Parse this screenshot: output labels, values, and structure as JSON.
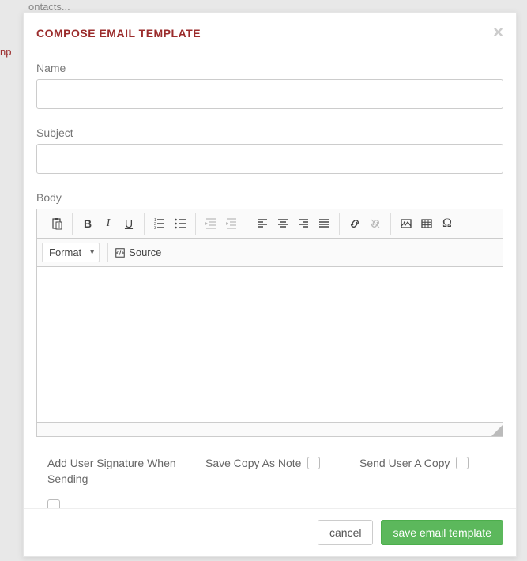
{
  "background": {
    "frag1": "ontacts...",
    "frag2": "np"
  },
  "modal": {
    "title": "COMPOSE EMAIL TEMPLATE",
    "close": "×"
  },
  "fields": {
    "name_label": "Name",
    "name_value": "",
    "subject_label": "Subject",
    "subject_value": "",
    "body_label": "Body"
  },
  "toolbar": {
    "format_label": "Format",
    "source_label": "Source"
  },
  "checkboxes": {
    "signature_label": "Add User Signature When Sending",
    "copy_note_label": "Save Copy As Note",
    "send_copy_label": "Send User A Copy"
  },
  "footer": {
    "cancel_label": "cancel",
    "save_label": "save email template"
  }
}
